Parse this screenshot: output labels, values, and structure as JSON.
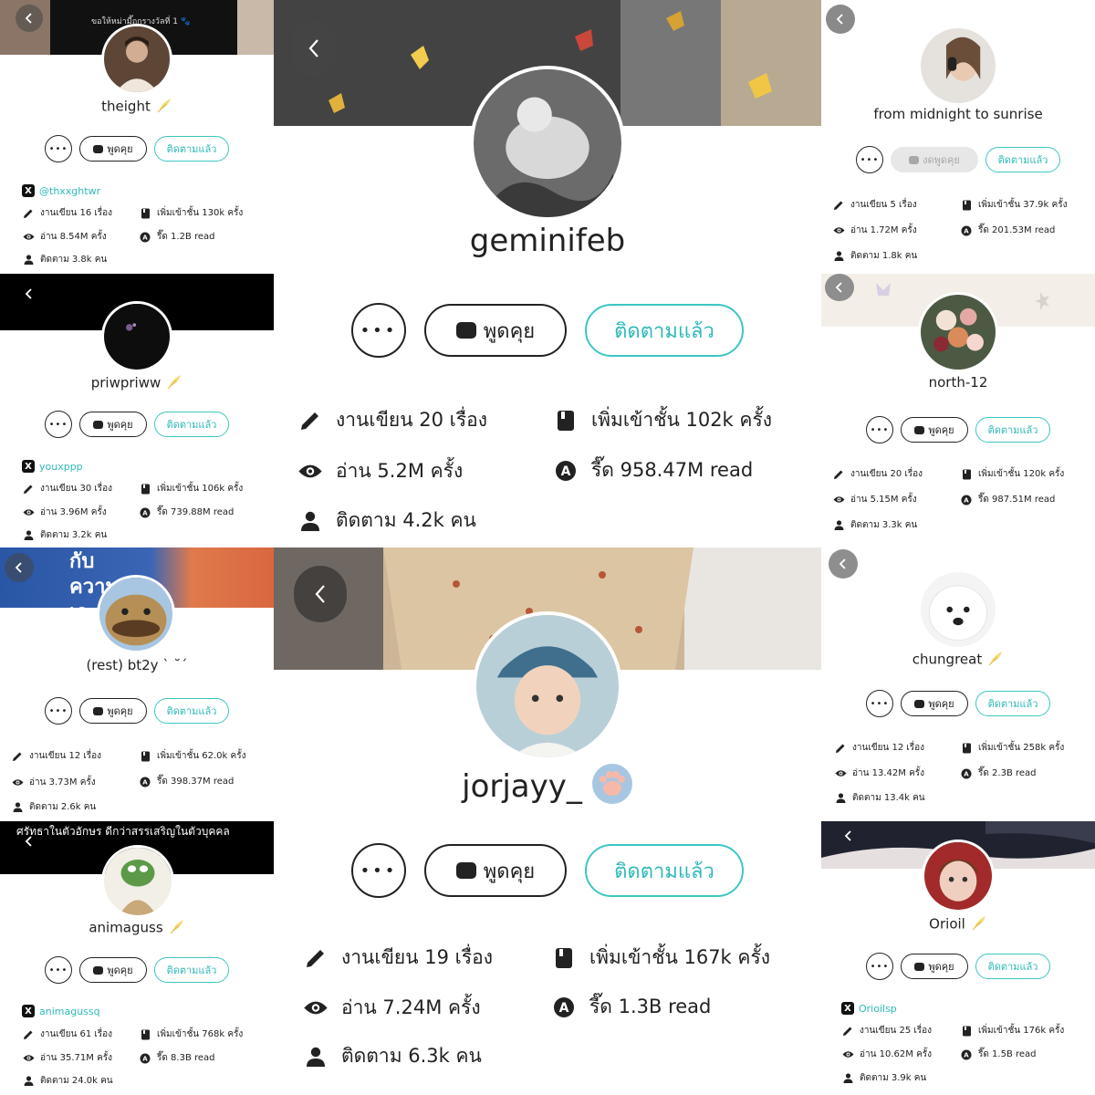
{
  "colors": {
    "accent": "#3cc6c4",
    "text": "#222222"
  },
  "common": {
    "chat_label": "พูดคุย",
    "chat_disabled_label": "งดพูดคุย",
    "follow_label": "ติดตามแล้ว",
    "more_label": "•••"
  },
  "profiles": [
    {
      "username": "theight",
      "quill": true,
      "x_handle": "@thxxghtwr",
      "banner_text": "ขอให้หม่ามี๊ถูกรางวัลที่ 1 🐾",
      "works": "งานเขียน 16 เรื่อง",
      "shelf": "เพิ่มเข้าชั้น 130k ครั้ง",
      "reads": "อ่าน 8.54M ครั้ง",
      "read_total": "รี๊ด 1.2B read",
      "followers": "ติดตาม 3.8k คน"
    },
    {
      "username": "geminifeb",
      "quill": false,
      "works": "งานเขียน 20 เรื่อง",
      "shelf": "เพิ่มเข้าชั้น 102k ครั้ง",
      "reads": "อ่าน 5.2M ครั้ง",
      "read_total": "รี๊ด 958.47M read",
      "followers": "ติดตาม 4.2k คน"
    },
    {
      "username": "from midnight to sunrise",
      "quill": false,
      "works": "งานเขียน 5 เรื่อง",
      "shelf": "เพิ่มเข้าชั้น 37.9k ครั้ง",
      "reads": "อ่าน 1.72M ครั้ง",
      "read_total": "รี๊ด 201.53M read",
      "followers": "ติดตาม 1.8k คน"
    },
    {
      "username": "priwpriww",
      "quill": true,
      "x_handle": "youxppp",
      "works": "งานเขียน 30 เรื่อง",
      "shelf": "เพิ่มเข้าชั้น 106k ครั้ง",
      "reads": "อ่าน 3.96M ครั้ง",
      "read_total": "รี๊ด 739.88M read",
      "followers": "ติดตาม 3.2k คน"
    },
    {
      "username": "north-12",
      "quill": false,
      "works": "งานเขียน 20 เรื่อง",
      "shelf": "เพิ่มเข้าชั้น 120k ครั้ง",
      "reads": "อ่าน 5.15M ครั้ง",
      "read_total": "รี๊ด 987.51M read",
      "followers": "ติดตาม 3.3k คน"
    },
    {
      "username": "(rest) bt2y ˋ ˘ˊ",
      "quill": false,
      "banner_text": "กับความ เจ",
      "works": "งานเขียน 12 เรื่อง",
      "shelf": "เพิ่มเข้าชั้น 62.0k ครั้ง",
      "reads": "อ่าน 3.73M ครั้ง",
      "read_total": "รี๊ด 398.37M read",
      "followers": "ติดตาม 2.6k คน"
    },
    {
      "username": "jorjayy_",
      "quill": false,
      "works": "งานเขียน 19 เรื่อง",
      "shelf": "เพิ่มเข้าชั้น 167k ครั้ง",
      "reads": "อ่าน 7.24M ครั้ง",
      "read_total": "รี๊ด 1.3B read",
      "followers": "ติดตาม 6.3k คน"
    },
    {
      "username": "chungreat",
      "quill": true,
      "works": "งานเขียน 12 เรื่อง",
      "shelf": "เพิ่มเข้าชั้น 258k ครั้ง",
      "reads": "อ่าน 13.42M ครั้ง",
      "read_total": "รี๊ด 2.3B read",
      "followers": "ติดตาม 13.4k คน"
    },
    {
      "username": "animaguss",
      "quill": true,
      "x_handle": "animagussq",
      "banner_text": "ศรัทธาในตัวอักษร ดีกว่าสรรเสริญในตัวบุคคล",
      "works": "งานเขียน 61 เรื่อง",
      "shelf": "เพิ่มเข้าชั้น 768k ครั้ง",
      "reads": "อ่าน 35.71M ครั้ง",
      "read_total": "รี๊ด 8.3B read",
      "followers": "ติดตาม 24.0k คน"
    },
    {
      "username": "Orioil",
      "quill": true,
      "x_handle": "Orioilsp",
      "works": "งานเขียน 25 เรื่อง",
      "shelf": "เพิ่มเข้าชั้น 176k ครั้ง",
      "reads": "อ่าน 10.62M ครั้ง",
      "read_total": "รี๊ด 1.5B read",
      "followers": "ติดตาม 3.9k คน"
    }
  ]
}
